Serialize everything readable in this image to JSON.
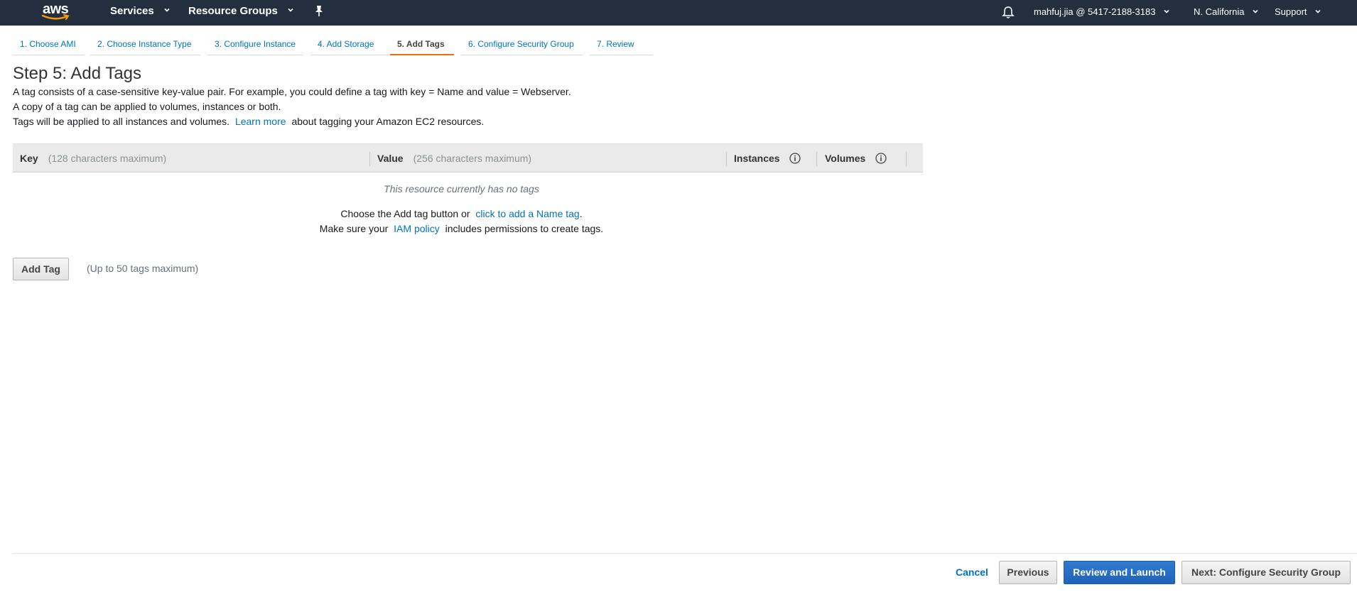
{
  "topnav": {
    "logo_text": "aws",
    "services": "Services",
    "resource_groups": "Resource Groups",
    "account": "mahfuj.jia @ 5417-2188-3183",
    "region": "N. California",
    "support": "Support"
  },
  "steps": [
    {
      "label": "1. Choose AMI"
    },
    {
      "label": "2. Choose Instance Type"
    },
    {
      "label": "3. Configure Instance"
    },
    {
      "label": "4. Add Storage"
    },
    {
      "label": "5. Add Tags"
    },
    {
      "label": "6. Configure Security Group"
    },
    {
      "label": "7. Review"
    }
  ],
  "page": {
    "title": "Step 5: Add Tags",
    "desc1": "A tag consists of a case-sensitive key-value pair. For example, you could define a tag with key = Name and value = Webserver.",
    "desc2": "A copy of a tag can be applied to volumes, instances or both.",
    "desc3_pre": "Tags will be applied to all instances and volumes.",
    "desc3_link": "Learn more",
    "desc3_post": "about tagging your Amazon EC2 resources."
  },
  "table": {
    "key_header": "Key",
    "key_hint": "(128 characters maximum)",
    "value_header": "Value",
    "value_hint": "(256 characters maximum)",
    "instances_header": "Instances",
    "volumes_header": "Volumes",
    "empty_message": "This resource currently has no tags",
    "help1_pre": "Choose the Add tag button or",
    "help1_link": "click to add a Name tag",
    "help1_post": ".",
    "help2_pre": "Make sure your",
    "help2_link": "IAM policy",
    "help2_post": "includes permissions to create tags."
  },
  "add_tag": {
    "button": "Add Tag",
    "hint": "(Up to 50 tags maximum)"
  },
  "footer": {
    "cancel": "Cancel",
    "previous": "Previous",
    "review_launch": "Review and Launch",
    "next": "Next: Configure Security Group"
  },
  "colors": {
    "nav_bg": "#232f3e",
    "link": "#0073bb",
    "active_step": "#ec7211",
    "primary": "#1f63b8"
  }
}
